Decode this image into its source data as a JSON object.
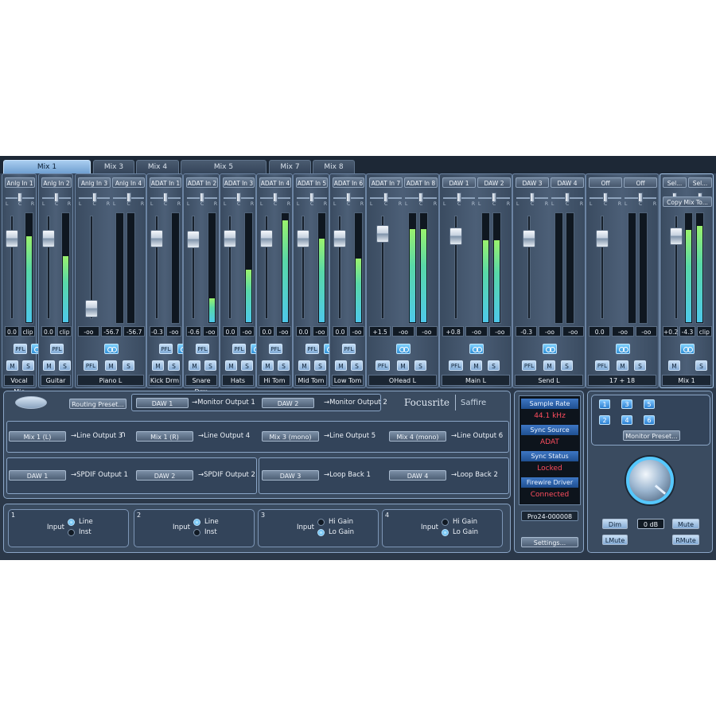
{
  "tabs": [
    "Mix 1",
    "Mix 3",
    "Mix 4",
    "Mix 5",
    "Mix 7",
    "Mix 8"
  ],
  "strips": [
    {
      "sources": [
        "Anlg In 1"
      ],
      "values": [
        "0.0",
        "clip"
      ],
      "name": "Vocal Mic",
      "pfl": true,
      "fader_level": 0.78,
      "meter_level": 0.78
    },
    {
      "sources": [
        "Anlg In 2"
      ],
      "values": [
        "0.0",
        "clip"
      ],
      "name": "Guitar",
      "pfl": true,
      "fader_level": 0.78,
      "meter_level": 0.6
    },
    {
      "sources": [
        "Anlg In 3",
        "Anlg In 4"
      ],
      "values": [
        "-oo",
        "-56.7",
        "-56.7"
      ],
      "name": "Piano L",
      "pfl": false,
      "fader_level": 0.1,
      "meter_level": 0.0
    },
    {
      "sources": [
        "ADAT In 1"
      ],
      "values": [
        "-0.3",
        "-oo"
      ],
      "name": "Kick Drm",
      "pfl": true,
      "fader_level": 0.78,
      "meter_level": 0.0
    },
    {
      "sources": [
        "ADAT In 2"
      ],
      "values": [
        "-0.6",
        "-oo"
      ],
      "name": "Snare Drm",
      "pfl": true,
      "fader_level": 0.77,
      "meter_level": 0.22
    },
    {
      "sources": [
        "ADAT In 3"
      ],
      "values": [
        "0.0",
        "-oo"
      ],
      "name": "Hats",
      "pfl": true,
      "fader_level": 0.78,
      "meter_level": 0.48
    },
    {
      "sources": [
        "ADAT In 4"
      ],
      "values": [
        "0.0",
        "-oo"
      ],
      "name": "Hi Tom",
      "pfl": true,
      "fader_level": 0.78,
      "meter_level": 0.93
    },
    {
      "sources": [
        "ADAT In 5"
      ],
      "values": [
        "0.0",
        "-oo"
      ],
      "name": "Mid Tom",
      "pfl": true,
      "fader_level": 0.78,
      "meter_level": 0.76
    },
    {
      "sources": [
        "ADAT In 6"
      ],
      "values": [
        "0.0",
        "-oo"
      ],
      "name": "Low Tom",
      "pfl": true,
      "fader_level": 0.78,
      "meter_level": 0.58
    },
    {
      "sources": [
        "ADAT In 7",
        "ADAT In 8"
      ],
      "values": [
        "+1.5",
        "-oo",
        "-oo"
      ],
      "name": "OHead L",
      "pfl": false,
      "fader_level": 0.82,
      "meter_level": 0.85
    },
    {
      "sources": [
        "DAW 1",
        "DAW 2"
      ],
      "values": [
        "+0.8",
        "-oo",
        "-oo"
      ],
      "name": "Main L",
      "pfl": false,
      "fader_level": 0.8,
      "meter_level": 0.75
    },
    {
      "sources": [
        "DAW 3",
        "DAW 4"
      ],
      "values": [
        "-0.3",
        "-oo",
        "-oo"
      ],
      "name": "Send L",
      "pfl": false,
      "fader_level": 0.78,
      "meter_level": 0.0
    },
    {
      "sources": [
        "Off",
        "Off"
      ],
      "values": [
        "0.0",
        "-oo",
        "-oo"
      ],
      "name": "17 + 18",
      "pfl": false,
      "fader_level": 0.78,
      "meter_level": 0.0
    },
    {
      "sources": [
        "Sel...",
        "Sel..."
      ],
      "values": [
        "+0.2",
        "-4.3",
        "clip"
      ],
      "name": "Mix 1",
      "pfl": false,
      "fader_level": 0.8,
      "meter_level": 0.88
    }
  ],
  "strip_buttons": {
    "pfl": "PFL",
    "mute": "M",
    "solo": "S"
  },
  "copy_mix_label": "Copy Mix To...",
  "routing": {
    "routing_preset": "Routing Preset...",
    "monitor_row": [
      {
        "source": "DAW 1",
        "dest": "→Monitor Output 1"
      },
      {
        "source": "DAW 2",
        "dest": "→Monitor Output 2"
      }
    ],
    "line_row": [
      {
        "source": "Mix 1 (L)",
        "dest": "→Line Output 3"
      },
      {
        "source": "Mix 1 (R)",
        "dest": "→Line Output 4"
      },
      {
        "source": "Mix 3 (mono)",
        "dest": "→Line Output 5"
      },
      {
        "source": "Mix 4 (mono)",
        "dest": "→Line Output 6"
      }
    ],
    "spdif_row": [
      {
        "source": "DAW 1",
        "dest": "→SPDIF Output 1"
      },
      {
        "source": "DAW 2",
        "dest": "→SPDIF Output 2"
      },
      {
        "source": "DAW 3",
        "dest": "→Loop Back 1"
      },
      {
        "source": "DAW 4",
        "dest": "→Loop Back 2"
      }
    ]
  },
  "brand": {
    "name": "Focusrite",
    "product": "Saffire"
  },
  "status": {
    "sample_rate_label": "Sample Rate",
    "sample_rate": "44.1 kHz",
    "sync_source_label": "Sync Source",
    "sync_source": "ADAT",
    "sync_status_label": "Sync Status",
    "sync_status": "Locked",
    "firewire_label": "Firewire Driver",
    "firewire": "Connected",
    "device_id": "Pro24-000008",
    "settings": "Settings..."
  },
  "inputs": [
    {
      "num": "1",
      "label": "Input",
      "opt1": "Line",
      "opt2": "Inst",
      "selected": 1
    },
    {
      "num": "2",
      "label": "Input",
      "opt1": "Line",
      "opt2": "Inst",
      "selected": 1
    },
    {
      "num": "3",
      "label": "Input",
      "opt1": "Hi Gain",
      "opt2": "Lo Gain",
      "selected": 2
    },
    {
      "num": "4",
      "label": "Input",
      "opt1": "Hi Gain",
      "opt2": "Lo Gain",
      "selected": 2
    }
  ],
  "monitor": {
    "presets": [
      "1",
      "3",
      "5",
      "2",
      "4",
      "6"
    ],
    "monitor_preset": "Monitor Preset...",
    "dim": "Dim",
    "level": "0 dB",
    "mute": "Mute",
    "lmute": "LMute",
    "rmute": "RMute",
    "knob_level": 0.85
  },
  "colors": {
    "accent": "#7fb4ea",
    "status_value": "#ff4d5e",
    "meter_top": "#9af26d",
    "meter_bottom": "#4ec8ea"
  }
}
